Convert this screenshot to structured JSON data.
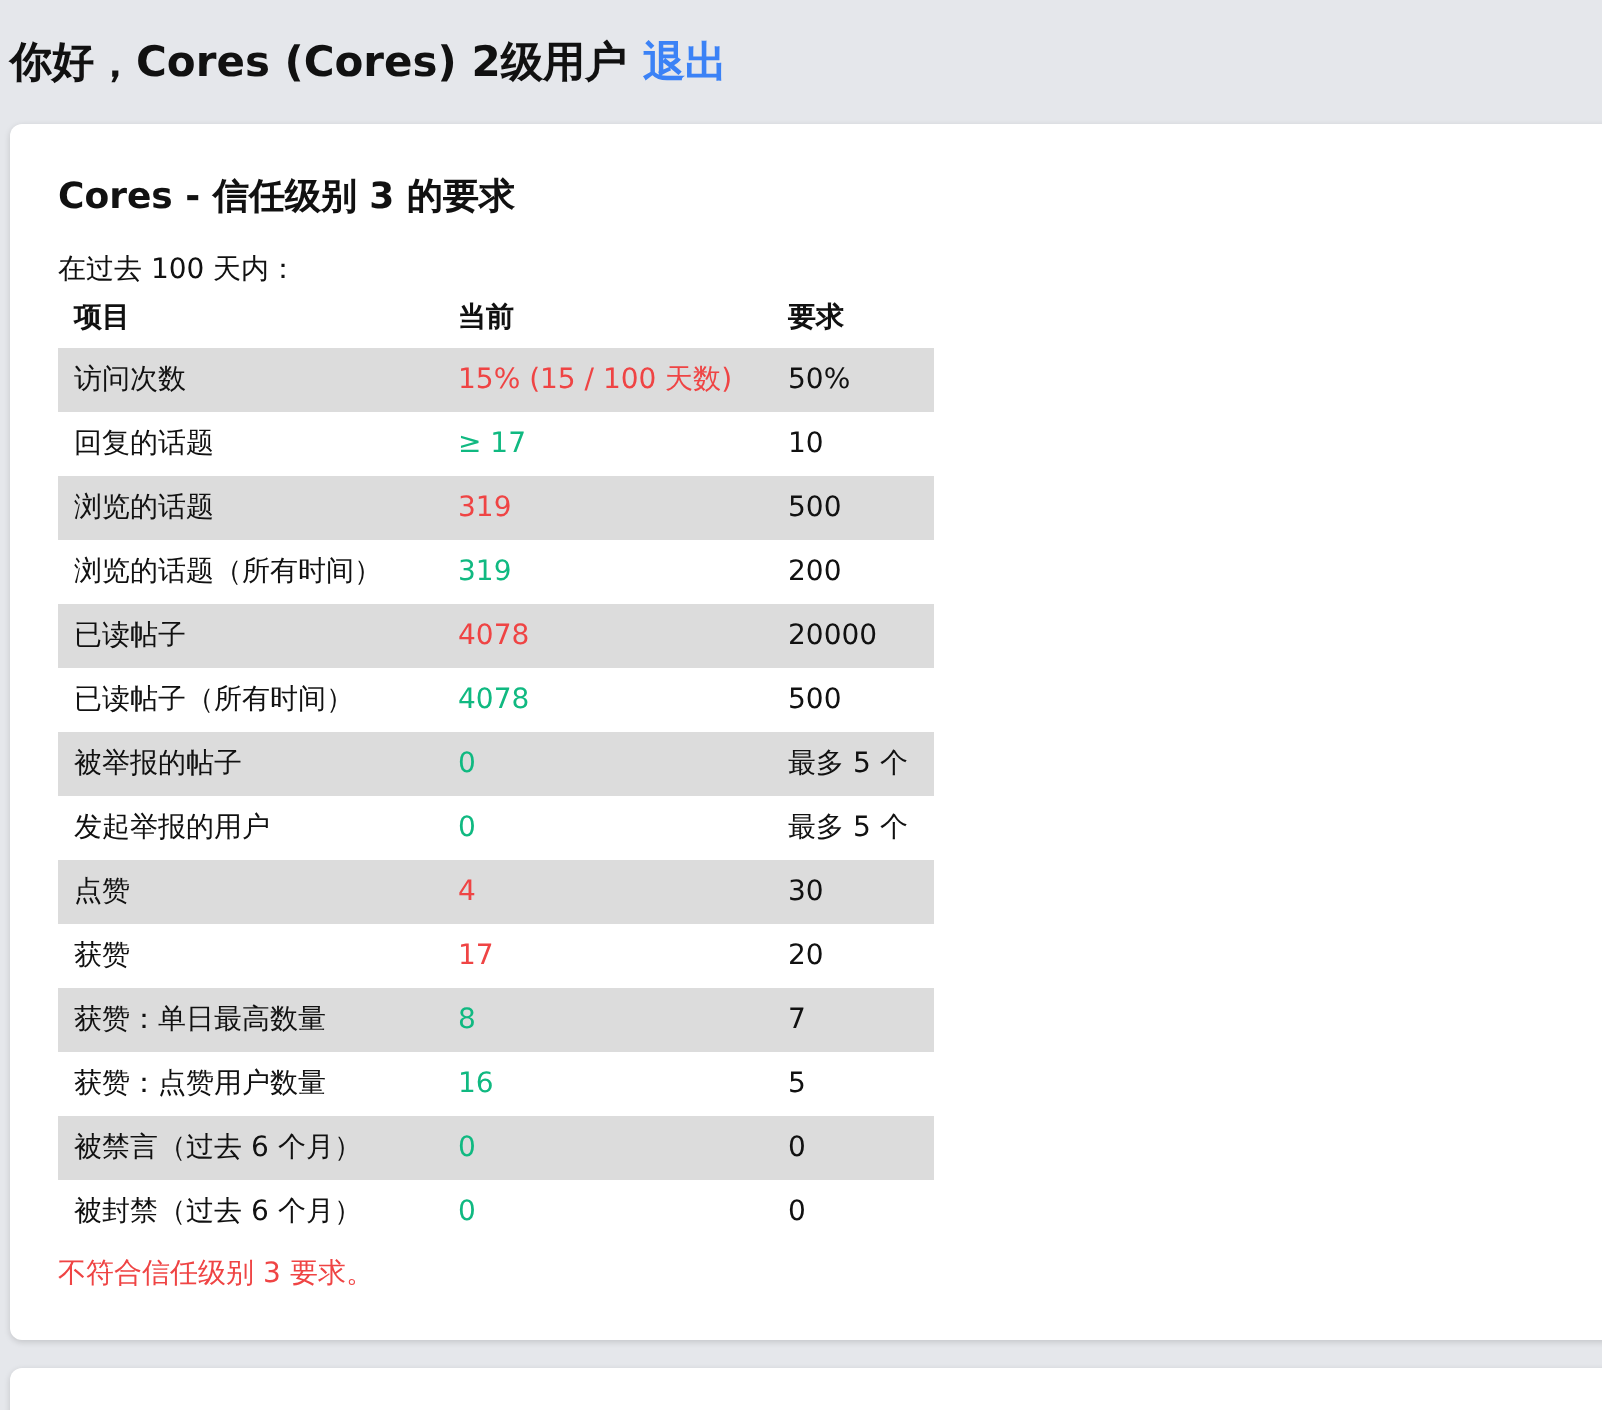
{
  "header": {
    "greeting": "你好，Cores (Cores) 2级用户",
    "logout_link": "退出"
  },
  "card": {
    "title": "Cores - 信任级别 3 的要求",
    "period": "在过去 100 天内：",
    "table": {
      "columns": [
        "项目",
        "当前",
        "要求"
      ],
      "rows": [
        {
          "item": "访问次数",
          "current": "15% (15 / 100 天数)",
          "required": "50%",
          "met": false
        },
        {
          "item": "回复的话题",
          "current": "≥ 17",
          "required": "10",
          "met": true
        },
        {
          "item": "浏览的话题",
          "current": "319",
          "required": "500",
          "met": false
        },
        {
          "item": "浏览的话题（所有时间）",
          "current": "319",
          "required": "200",
          "met": true
        },
        {
          "item": "已读帖子",
          "current": "4078",
          "required": "20000",
          "met": false
        },
        {
          "item": "已读帖子（所有时间）",
          "current": "4078",
          "required": "500",
          "met": true
        },
        {
          "item": "被举报的帖子",
          "current": "0",
          "required": "最多 5 个",
          "met": true
        },
        {
          "item": "发起举报的用户",
          "current": "0",
          "required": "最多 5 个",
          "met": true
        },
        {
          "item": "点赞",
          "current": "4",
          "required": "30",
          "met": false
        },
        {
          "item": "获赞",
          "current": "17",
          "required": "20",
          "met": false
        },
        {
          "item": "获赞：单日最高数量",
          "current": "8",
          "required": "7",
          "met": true
        },
        {
          "item": "获赞：点赞用户数量",
          "current": "16",
          "required": "5",
          "met": true
        },
        {
          "item": "被禁言（过去 6 个月）",
          "current": "0",
          "required": "0",
          "met": true
        },
        {
          "item": "被封禁（过去 6 个月）",
          "current": "0",
          "required": "0",
          "met": true
        }
      ]
    },
    "result": "不符合信任级别 3 要求。"
  }
}
